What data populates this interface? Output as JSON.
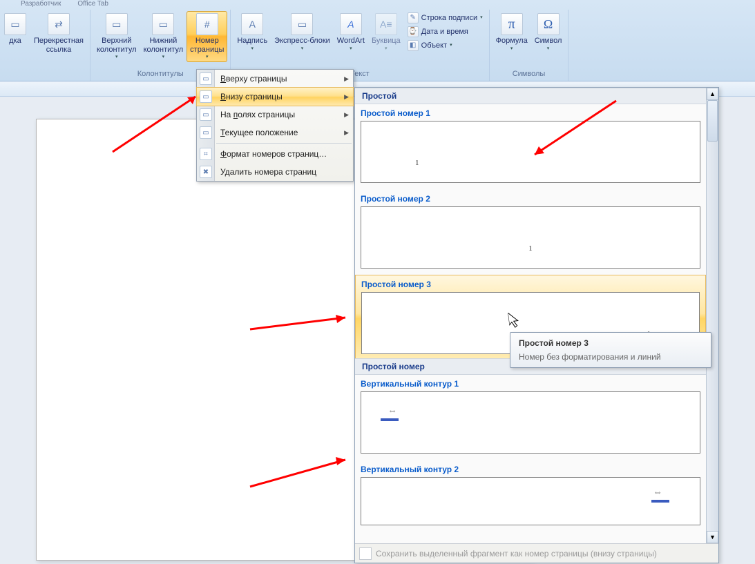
{
  "tabs": {
    "t1": "Разработчик",
    "t2": "Office Tab"
  },
  "ribbon": {
    "groups": {
      "links": {
        "ref_table": "дка",
        "cross_ref": "Перекрестная\nссылка"
      },
      "headers": {
        "label": "Колонтитулы",
        "header": "Верхний\nколонтитул",
        "footer": "Нижний\nколонтитул",
        "pagenum": "Номер\nстраницы"
      },
      "text": {
        "label": "Текст",
        "textbox": "Надпись",
        "quick": "Экспресс-блоки",
        "wordart": "WordArt",
        "dropcap": "Буквица",
        "sigline": "Строка подписи",
        "datetime": "Дата и время",
        "object": "Объект"
      },
      "symbols": {
        "label": "Символы",
        "equation": "Формула",
        "symbol": "Символ"
      }
    }
  },
  "menu": {
    "top_of_page": "Вверху страницы",
    "bottom_of_page": "Внизу страницы",
    "margins": "На полях страницы",
    "current_pos": "Текущее положение",
    "format": "Формат номеров страниц…",
    "remove": "Удалить номера страниц"
  },
  "gallery": {
    "section_simple": "Простой",
    "items": [
      {
        "title": "Простой номер 1",
        "align": "left"
      },
      {
        "title": "Простой номер 2",
        "align": "center"
      },
      {
        "title": "Простой номер 3",
        "align": "right"
      }
    ],
    "section_simple_number": "Простой номер",
    "items2": [
      {
        "title": "Вертикальный контур 1",
        "align": "left"
      },
      {
        "title": "Вертикальный контур 2",
        "align": "right"
      }
    ],
    "sample_number": "1",
    "footer": "Сохранить выделенный фрагмент как номер страницы (внизу страницы)"
  },
  "tooltip": {
    "title": "Простой номер 3",
    "body": "Номер без форматирования и линий"
  },
  "icons": {
    "page": "▭",
    "arrow": "▸",
    "pi": "π",
    "omega": "Ω",
    "A": "A"
  }
}
